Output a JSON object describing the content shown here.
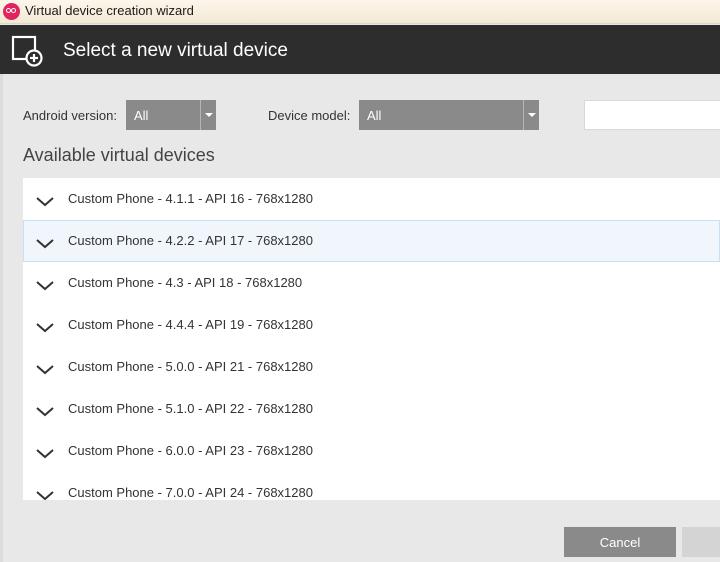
{
  "window": {
    "title": "Virtual device creation wizard"
  },
  "header": {
    "title": "Select a new virtual device",
    "icon": "add-device-icon"
  },
  "filters": {
    "android_version_label": "Android version:",
    "android_version_value": "All",
    "device_model_label": "Device model:",
    "device_model_value": "All",
    "search_value": ""
  },
  "list": {
    "title": "Available virtual devices",
    "items": [
      {
        "label": "Custom Phone - 4.1.1 - API 16 - 768x1280"
      },
      {
        "label": "Custom Phone - 4.2.2 - API 17 - 768x1280"
      },
      {
        "label": "Custom Phone - 4.3 - API 18 - 768x1280"
      },
      {
        "label": "Custom Phone - 4.4.4 - API 19 - 768x1280"
      },
      {
        "label": "Custom Phone - 5.0.0 - API 21 - 768x1280"
      },
      {
        "label": "Custom Phone - 5.1.0 - API 22 - 768x1280"
      },
      {
        "label": "Custom Phone - 6.0.0 - API 23 - 768x1280"
      },
      {
        "label": "Custom Phone - 7.0.0 - API 24 - 768x1280"
      }
    ],
    "selected_index": 1
  },
  "footer": {
    "cancel_label": "Cancel",
    "next_label": ""
  },
  "colors": {
    "header_bg": "#2d2d2d",
    "select_bg": "#8a8a8a",
    "app_icon": "#e0245e"
  }
}
